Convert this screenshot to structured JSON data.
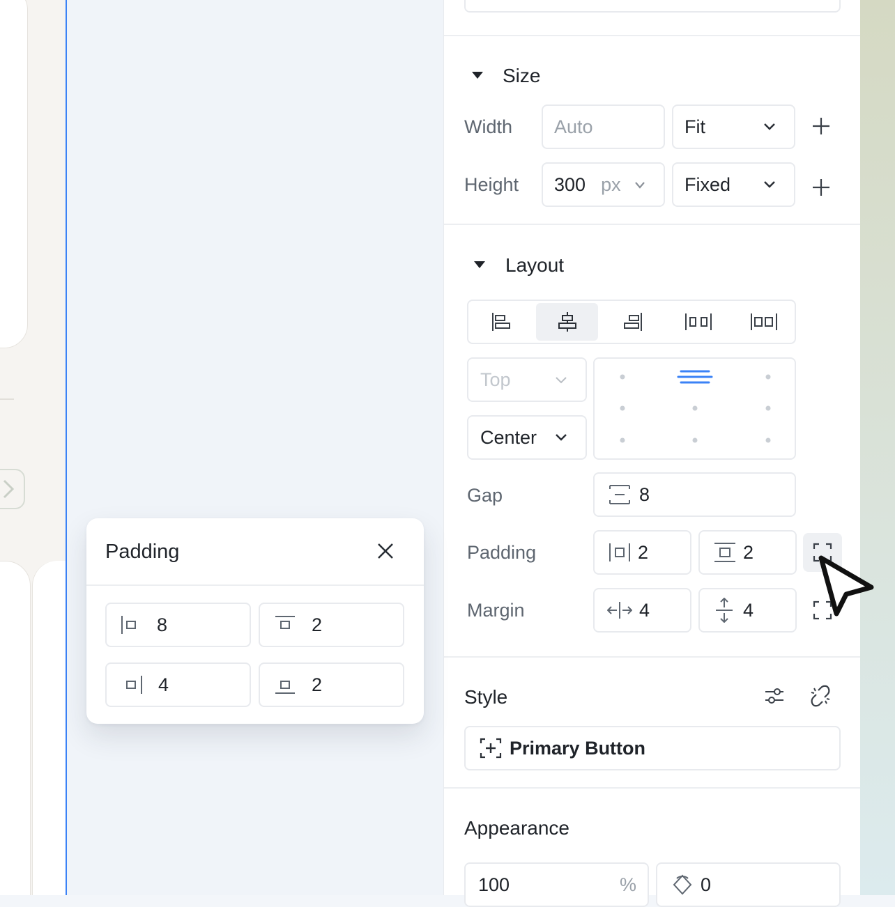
{
  "size": {
    "title": "Size",
    "width_label": "Width",
    "width_value": "Auto",
    "width_mode": "Fit",
    "height_label": "Height",
    "height_value": "300",
    "height_unit": "px",
    "height_mode": "Fixed"
  },
  "layout": {
    "title": "Layout",
    "vertical_align": "Top",
    "horizontal_align": "Center",
    "gap_label": "Gap",
    "gap_value": "8",
    "padding_label": "Padding",
    "padding_h": "2",
    "padding_v": "2",
    "margin_label": "Margin",
    "margin_h": "4",
    "margin_v": "4"
  },
  "style": {
    "title": "Style",
    "preset": "Primary Button"
  },
  "appearance": {
    "title": "Appearance",
    "opacity": "100",
    "opacity_unit": "%",
    "radius": "0"
  },
  "popover": {
    "title": "Padding",
    "left": "8",
    "top": "2",
    "right": "4",
    "bottom": "2"
  },
  "colors": {
    "accent": "#3b82f6",
    "selected_bg": "#eef0f3"
  }
}
